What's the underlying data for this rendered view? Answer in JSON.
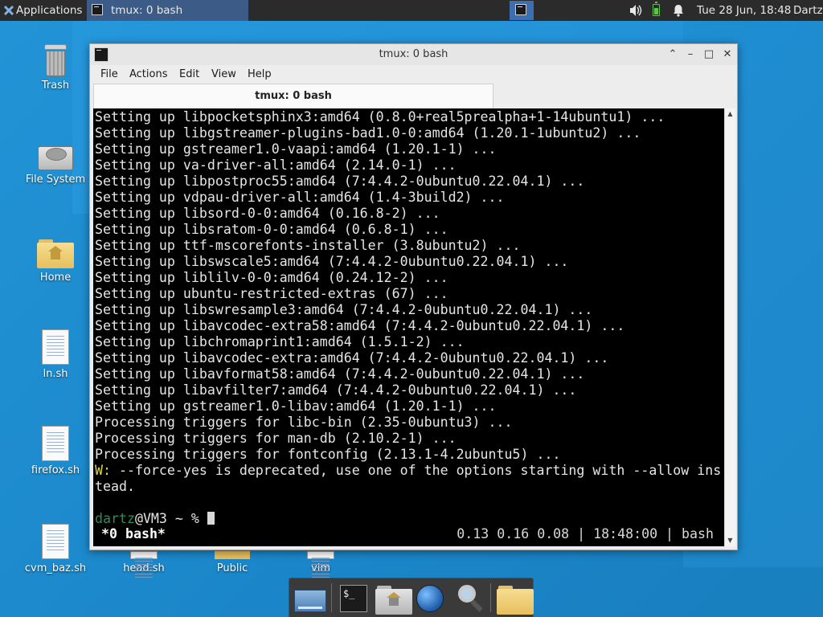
{
  "top_panel": {
    "applications_label": "Applications",
    "task_button_label": "tmux: 0 bash",
    "clock": "Tue 28 Jun, 18:48",
    "user": "Dartz"
  },
  "desktop_icons": [
    {
      "label": "Trash"
    },
    {
      "label": "File System"
    },
    {
      "label": "Home"
    },
    {
      "label": "ln.sh"
    },
    {
      "label": "firefox.sh"
    },
    {
      "label": "cvm_baz.sh"
    },
    {
      "label": "head.sh"
    },
    {
      "label": "Public"
    },
    {
      "label": "vim"
    }
  ],
  "window": {
    "title": "tmux: 0 bash",
    "menu": [
      "File",
      "Actions",
      "Edit",
      "View",
      "Help"
    ],
    "tab_label": "tmux: 0 bash"
  },
  "terminal": {
    "lines": [
      "Setting up libpocketsphinx3:amd64 (0.8.0+real5prealpha+1-14ubuntu1) ...",
      "Setting up libgstreamer-plugins-bad1.0-0:amd64 (1.20.1-1ubuntu2) ...",
      "Setting up gstreamer1.0-vaapi:amd64 (1.20.1-1) ...",
      "Setting up va-driver-all:amd64 (2.14.0-1) ...",
      "Setting up libpostproc55:amd64 (7:4.4.2-0ubuntu0.22.04.1) ...",
      "Setting up vdpau-driver-all:amd64 (1.4-3build2) ...",
      "Setting up libsord-0-0:amd64 (0.16.8-2) ...",
      "Setting up libsratom-0-0:amd64 (0.6.8-1) ...",
      "Setting up ttf-mscorefonts-installer (3.8ubuntu2) ...",
      "Setting up libswscale5:amd64 (7:4.4.2-0ubuntu0.22.04.1) ...",
      "Setting up liblilv-0-0:amd64 (0.24.12-2) ...",
      "Setting up ubuntu-restricted-extras (67) ...",
      "Setting up libswresample3:amd64 (7:4.4.2-0ubuntu0.22.04.1) ...",
      "Setting up libavcodec-extra58:amd64 (7:4.4.2-0ubuntu0.22.04.1) ...",
      "Setting up libchromaprint1:amd64 (1.5.1-2) ...",
      "Setting up libavcodec-extra:amd64 (7:4.4.2-0ubuntu0.22.04.1) ...",
      "Setting up libavformat58:amd64 (7:4.4.2-0ubuntu0.22.04.1) ...",
      "Setting up libavfilter7:amd64 (7:4.4.2-0ubuntu0.22.04.1) ...",
      "Setting up gstreamer1.0-libav:amd64 (1.20.1-1) ...",
      "Processing triggers for libc-bin (2.35-0ubuntu3) ...",
      "Processing triggers for man-db (2.10.2-1) ...",
      "Processing triggers for fontconfig (2.13.1-4.2ubuntu5) ..."
    ],
    "warning_prefix": "W:",
    "warning_line1": " --force-yes is deprecated, use one of the options starting with --allow ins",
    "warning_line2": "tead.",
    "prompt_user": "dartz",
    "prompt_rest": "@VM3 ~ % ",
    "status_left": "*0 bash*",
    "status_right": "0.13 0.16 0.08 | 18:48:00 | bash"
  },
  "colors": {
    "desktop": "#1f8ed0",
    "panel": "#2b2b2b",
    "terminal_bg": "#000000",
    "terminal_fg": "#e5e5e5",
    "warning": "#e0d64a",
    "prompt_user": "#2e8b57"
  }
}
